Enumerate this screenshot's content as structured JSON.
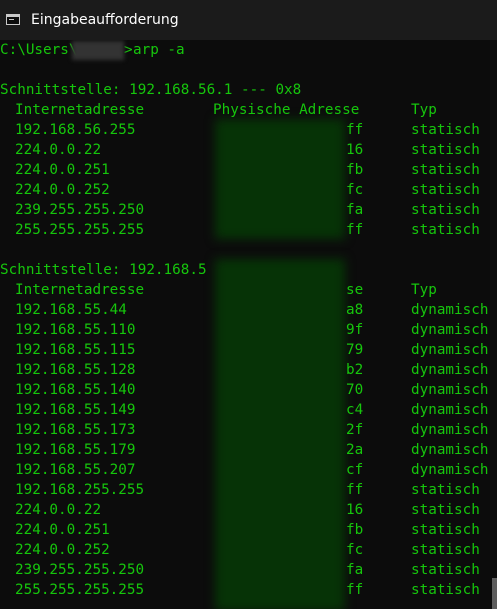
{
  "window": {
    "title": "Eingabeaufforderung"
  },
  "command": {
    "prefix": "C:\\Users\\",
    "separator": ">",
    "text": "arp -a"
  },
  "sections": [
    {
      "header": "Schnittstelle: 192.168.56.1 --- 0x8",
      "columns": {
        "ip": "Internetadresse",
        "mac": "Physische Adresse",
        "type": "Typ"
      },
      "rows": [
        {
          "ip": "192.168.56.255",
          "mac_suffix": "ff",
          "type": "statisch"
        },
        {
          "ip": "224.0.0.22",
          "mac_suffix": "16",
          "type": "statisch"
        },
        {
          "ip": "224.0.0.251",
          "mac_suffix": "fb",
          "type": "statisch"
        },
        {
          "ip": "224.0.0.252",
          "mac_suffix": "fc",
          "type": "statisch"
        },
        {
          "ip": "239.255.255.250",
          "mac_suffix": "fa",
          "type": "statisch"
        },
        {
          "ip": "255.255.255.255",
          "mac_suffix": "ff",
          "type": "statisch"
        }
      ]
    },
    {
      "header": "Schnittstelle: 192.168.5",
      "columns": {
        "ip": "Internetadresse",
        "mac": "se",
        "type": "Typ"
      },
      "rows": [
        {
          "ip": "192.168.55.44",
          "mac_suffix": "a8",
          "type": "dynamisch"
        },
        {
          "ip": "192.168.55.110",
          "mac_suffix": "9f",
          "type": "dynamisch"
        },
        {
          "ip": "192.168.55.115",
          "mac_suffix": "79",
          "type": "dynamisch"
        },
        {
          "ip": "192.168.55.128",
          "mac_suffix": "b2",
          "type": "dynamisch"
        },
        {
          "ip": "192.168.55.140",
          "mac_suffix": "70",
          "type": "dynamisch"
        },
        {
          "ip": "192.168.55.149",
          "mac_suffix": "c4",
          "type": "dynamisch"
        },
        {
          "ip": "192.168.55.173",
          "mac_suffix": "2f",
          "type": "dynamisch"
        },
        {
          "ip": "192.168.55.179",
          "mac_suffix": "2a",
          "type": "dynamisch"
        },
        {
          "ip": "192.168.55.207",
          "mac_suffix": "cf",
          "type": "dynamisch"
        },
        {
          "ip": "192.168.255.255",
          "mac_suffix": "ff",
          "type": "statisch"
        },
        {
          "ip": "224.0.0.22",
          "mac_suffix": "16",
          "type": "statisch"
        },
        {
          "ip": "224.0.0.251",
          "mac_suffix": "fb",
          "type": "statisch"
        },
        {
          "ip": "224.0.0.252",
          "mac_suffix": "fc",
          "type": "statisch"
        },
        {
          "ip": "239.255.255.250",
          "mac_suffix": "fa",
          "type": "statisch"
        },
        {
          "ip": "255.255.255.255",
          "mac_suffix": "ff",
          "type": "statisch"
        }
      ]
    }
  ],
  "colors": {
    "text": "#16c60c",
    "background": "#0c0c0c",
    "titlebar": "#1b1b1b"
  },
  "icons": {
    "title": "console-icon"
  }
}
